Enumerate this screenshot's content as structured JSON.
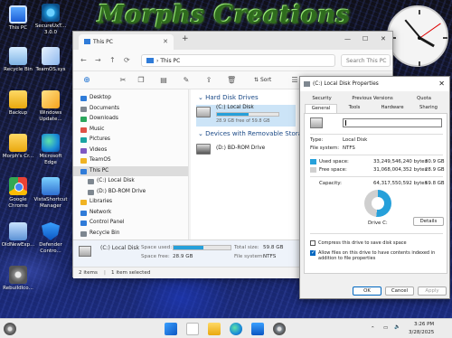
{
  "desktop": {
    "banner": "Morphs Creations",
    "icons": [
      {
        "label": "This PC",
        "icon": "this-pc-icon"
      },
      {
        "label": "SecureUxT... 3.0.0",
        "icon": "secure-ux-icon"
      },
      {
        "label": "Recycle Bin",
        "icon": "recycle-bin-icon"
      },
      {
        "label": "TeamOS.sys",
        "icon": "teamos-icon"
      },
      {
        "label": "Backup",
        "icon": "folder-icon"
      },
      {
        "label": "Windows Update...",
        "icon": "windows-update-icon"
      },
      {
        "label": "Morph's Cr...",
        "icon": "folder-icon"
      },
      {
        "label": "Microsoft Edge",
        "icon": "edge-icon"
      },
      {
        "label": "Google Chrome",
        "icon": "chrome-icon"
      },
      {
        "label": "VistaShortcut Manager",
        "icon": "vista-shortcut-icon"
      },
      {
        "label": "OldNewExp...",
        "icon": "old-new-explorer-icon"
      },
      {
        "label": "Defender Contro...",
        "icon": "defender-icon"
      },
      {
        "label": "RebuildIco...",
        "icon": "rebuild-icon"
      }
    ]
  },
  "explorer": {
    "tab_title": "This PC",
    "new_tab": "+",
    "address": "This PC",
    "search_placeholder": "Search This PC",
    "sort_label": "Sort",
    "sidebar": [
      {
        "label": "Desktop",
        "color": "#2f7bd8"
      },
      {
        "label": "Documents",
        "color": "#7e8790"
      },
      {
        "label": "Downloads",
        "color": "#2aa65c"
      },
      {
        "label": "Music",
        "color": "#e05046"
      },
      {
        "label": "Pictures",
        "color": "#1aa3a3"
      },
      {
        "label": "Videos",
        "color": "#7e57c2"
      },
      {
        "label": "TeamOS",
        "color": "#f0b323"
      },
      {
        "label": "This PC",
        "color": "#2f7bd8"
      },
      {
        "label": "(C:) Local Disk",
        "color": "#7e8790"
      },
      {
        "label": "(D:) BD-ROM Drive",
        "color": "#7e8790"
      },
      {
        "label": "Libraries",
        "color": "#f0b323"
      },
      {
        "label": "Network",
        "color": "#2f7bd8"
      },
      {
        "label": "Control Panel",
        "color": "#2f7bd8"
      },
      {
        "label": "Recycle Bin",
        "color": "#7e8790"
      }
    ],
    "hard_disk_header": "Hard Disk Drives",
    "removable_header": "Devices with Removable Storage",
    "drive_c": {
      "name": "(C:) Local Disk",
      "free_text": "28.9 GB free of 59.8 GB",
      "used_fraction": 0.52
    },
    "drive_d": {
      "name": "(D:) BD-ROM Drive"
    },
    "details": {
      "name": "(C:) Local Disk",
      "space_used_label": "Space used:",
      "space_free_label": "Space free:",
      "space_free": "28.9 GB",
      "total_size_label": "Total size:",
      "total_size": "59.8 GB",
      "file_system_label": "File system:",
      "file_system": "NTFS"
    },
    "status": {
      "items": "2 items",
      "selected": "1 item selected"
    }
  },
  "props": {
    "title": "(C:) Local Disk Properties",
    "tabs_row1": [
      "Security",
      "Previous Versions",
      "Quota"
    ],
    "tabs_row2": [
      "General",
      "Tools",
      "Hardware",
      "Sharing"
    ],
    "type_label": "Type:",
    "type_value": "Local Disk",
    "fs_label": "File system:",
    "fs_value": "NTFS",
    "used_label": "Used space:",
    "used_bytes": "33,249,546,240 bytes",
    "used_gb": "30.9 GB",
    "free_label": "Free space:",
    "free_bytes": "31,068,004,352 bytes",
    "free_gb": "28.9 GB",
    "cap_label": "Capacity:",
    "cap_bytes": "64,317,550,592 bytes",
    "cap_gb": "59.8 GB",
    "drive_label": "Drive C:",
    "details_btn": "Details",
    "compress_label": "Compress this drive to save disk space",
    "index_label": "Allow files on this drive to have contents indexed in addition to file properties",
    "ok": "OK",
    "cancel": "Cancel",
    "apply": "Apply",
    "used_color": "#26a0da",
    "free_color": "#cfcfcf"
  },
  "taskbar": {
    "time": "3:26 PM",
    "date": "3/28/2025"
  }
}
